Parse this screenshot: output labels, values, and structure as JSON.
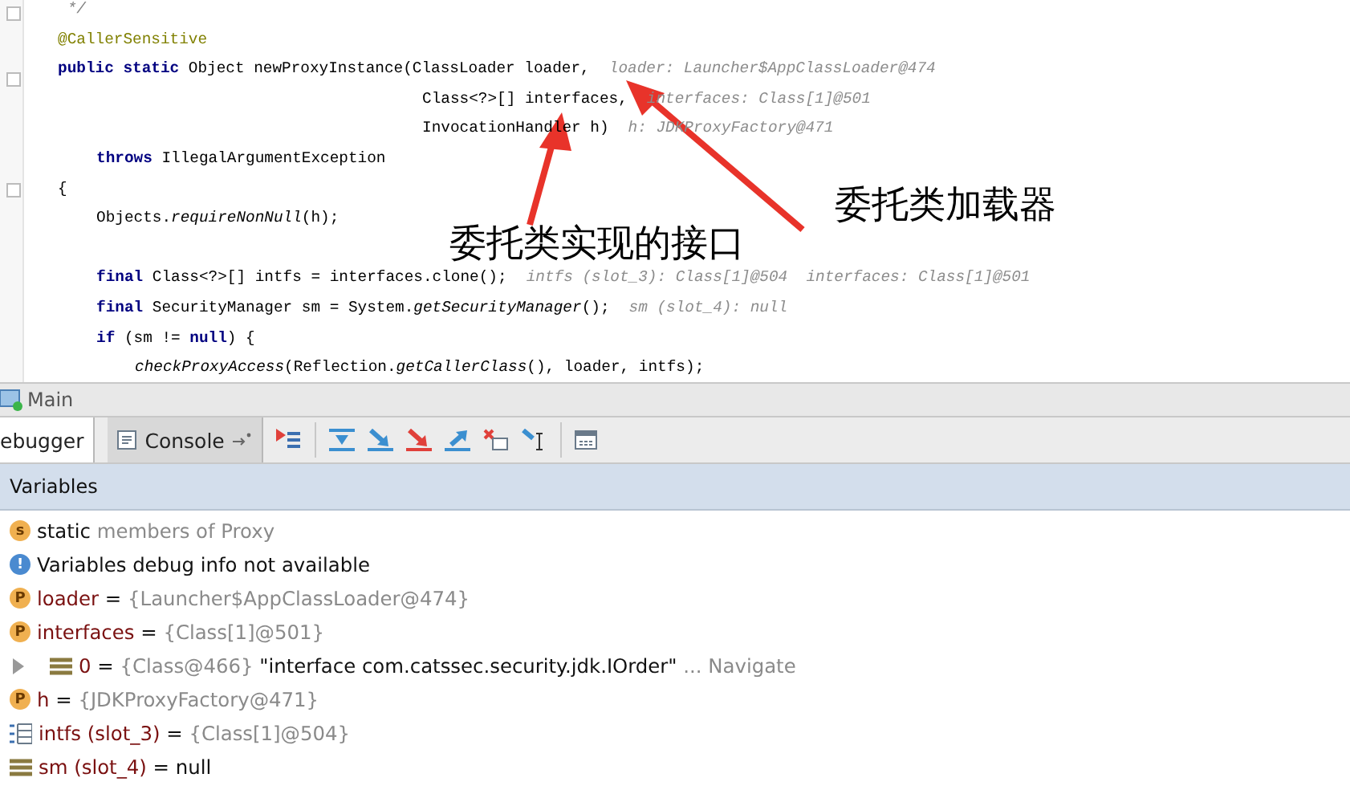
{
  "code": {
    "lines": [
      {
        "kind": "comment",
        "tokens": [
          {
            "text": " */",
            "kind": "comment"
          }
        ]
      },
      {
        "kind": "member",
        "tokens": [
          {
            "text": "@CallerSensitive",
            "kind": "annotation"
          }
        ]
      },
      {
        "kind": "member",
        "tokens": [
          {
            "text": "public static",
            "kind": "keyword"
          },
          {
            "text": " Object newProxyInstance(ClassLoader loader,",
            "kind": "plain"
          }
        ],
        "hint": "loader: Launcher$AppClassLoader@474"
      },
      {
        "kind": "param",
        "tokens": [
          {
            "text": "Class<?>[] interfaces,",
            "kind": "plain"
          }
        ],
        "hint": "interfaces: Class[1]@501"
      },
      {
        "kind": "param",
        "tokens": [
          {
            "text": "InvocationHandler h)",
            "kind": "plain"
          }
        ],
        "hint": "h: JDKProxyFactory@471"
      },
      {
        "kind": "body",
        "tokens": [
          {
            "text": "throws",
            "kind": "keyword"
          },
          {
            "text": " IllegalArgumentException",
            "kind": "plain"
          }
        ]
      },
      {
        "kind": "member",
        "tokens": [
          {
            "text": "{",
            "kind": "plain"
          }
        ]
      },
      {
        "kind": "body",
        "tokens": [
          {
            "text": "Objects.",
            "kind": "plain"
          },
          {
            "text": "requireNonNull",
            "kind": "call"
          },
          {
            "text": "(h);",
            "kind": "plain"
          }
        ]
      },
      {
        "kind": "blank"
      },
      {
        "kind": "body",
        "tokens": [
          {
            "text": "final",
            "kind": "keyword"
          },
          {
            "text": " Class<?>[] intfs = interfaces.clone();",
            "kind": "plain"
          }
        ],
        "hint": "intfs (slot_3): Class[1]@504  interfaces: Class[1]@501"
      },
      {
        "kind": "body",
        "tokens": [
          {
            "text": "final",
            "kind": "keyword"
          },
          {
            "text": " SecurityManager sm = System.",
            "kind": "plain"
          },
          {
            "text": "getSecurityManager",
            "kind": "call"
          },
          {
            "text": "();",
            "kind": "plain"
          }
        ],
        "hint": "sm (slot_4): null"
      },
      {
        "kind": "body",
        "tokens": [
          {
            "text": "if",
            "kind": "keyword"
          },
          {
            "text": " (sm != ",
            "kind": "plain"
          },
          {
            "text": "null",
            "kind": "keyword"
          },
          {
            "text": ") {",
            "kind": "plain"
          }
        ]
      },
      {
        "kind": "nested",
        "tokens": [
          {
            "text": "checkProxyAccess",
            "kind": "call"
          },
          {
            "text": "(Reflection.",
            "kind": "plain"
          },
          {
            "text": "getCallerClass",
            "kind": "call"
          },
          {
            "text": "(), loader, intfs);",
            "kind": "plain"
          }
        ]
      }
    ]
  },
  "callouts": [
    {
      "text": "委托类实现的接口"
    },
    {
      "text": "委托类加载器"
    }
  ],
  "session": {
    "title": "Main"
  },
  "tabs": [
    {
      "label": "ebugger",
      "selected": true
    },
    {
      "label": "Console",
      "selected": false
    }
  ],
  "variables": {
    "title": "Variables",
    "rows": [
      {
        "kind": "static",
        "badge": "s",
        "parts": [
          {
            "text": "static",
            "kind": "plain"
          },
          {
            "text": " members of Proxy",
            "kind": "value"
          }
        ]
      },
      {
        "kind": "info",
        "badge": "!",
        "parts": [
          {
            "text": "Variables debug info not available",
            "kind": "plain"
          }
        ]
      },
      {
        "kind": "param",
        "badge": "P",
        "parts": [
          {
            "text": "loader",
            "kind": "name"
          },
          {
            "text": " = ",
            "kind": "plain"
          },
          {
            "text": "{Launcher$AppClassLoader@474}",
            "kind": "value"
          }
        ]
      },
      {
        "kind": "param",
        "badge": "P",
        "parts": [
          {
            "text": "interfaces",
            "kind": "name"
          },
          {
            "text": " = ",
            "kind": "plain"
          },
          {
            "text": "{Class[1]@501}",
            "kind": "value"
          }
        ],
        "children": [
          {
            "kind": "field",
            "expanded": false,
            "parts": [
              {
                "text": "0",
                "kind": "name"
              },
              {
                "text": " = ",
                "kind": "plain"
              },
              {
                "text": "{Class@466}",
                "kind": "value"
              },
              {
                "text": " \"interface com.catssec.security.jdk.IOrder\"",
                "kind": "plain"
              },
              {
                "text": " ... Navigate",
                "kind": "value"
              }
            ]
          }
        ]
      },
      {
        "kind": "param",
        "badge": "P",
        "parts": [
          {
            "text": "h",
            "kind": "name"
          },
          {
            "text": " = ",
            "kind": "plain"
          },
          {
            "text": "{JDKProxyFactory@471}",
            "kind": "value"
          }
        ]
      },
      {
        "kind": "array",
        "parts": [
          {
            "text": "intfs (slot_3)",
            "kind": "name"
          },
          {
            "text": " = ",
            "kind": "plain"
          },
          {
            "text": "{Class[1]@504}",
            "kind": "value"
          }
        ]
      },
      {
        "kind": "field",
        "parts": [
          {
            "text": "sm (slot_4)",
            "kind": "name"
          },
          {
            "text": " = ",
            "kind": "plain"
          },
          {
            "text": "null",
            "kind": "plain"
          }
        ]
      }
    ]
  }
}
